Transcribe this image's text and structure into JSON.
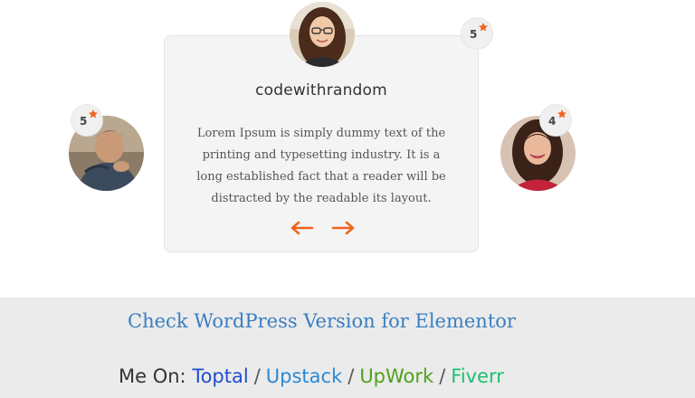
{
  "testimonial": {
    "author": "codewithrandom",
    "quote": "Lorem Ipsum is simply dummy text of the printing and typesetting industry. It is a long established fact that a reader will be distracted by the readable its layout."
  },
  "ratings": {
    "center": "5",
    "left": "5",
    "right": "4"
  },
  "footer": {
    "wp_link": "Check WordPress Version for Elementor",
    "me_on_label": "Me On:",
    "links": [
      "Toptal",
      "Upstack",
      "UpWork",
      "Fiverr"
    ],
    "separator": "/"
  },
  "colors": {
    "accent": "#f0641e",
    "toptal": "#204ecf",
    "upstack": "#2b8ad6",
    "upwork": "#4fa11a",
    "fiverr": "#1dbf73",
    "wp_link": "#3a7ec2"
  },
  "icons": {
    "prev": "arrow-left-icon",
    "next": "arrow-right-icon",
    "rating": "star-icon"
  }
}
